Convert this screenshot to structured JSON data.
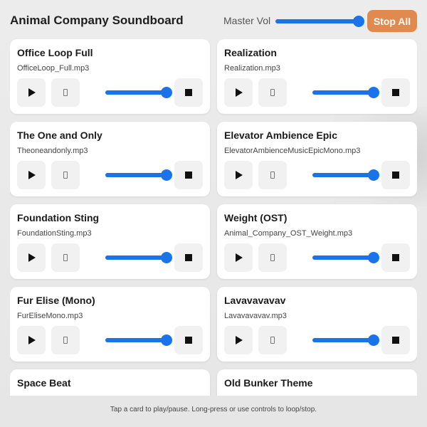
{
  "header": {
    "title": "Animal Company Soundboard",
    "master_vol_label": "Master Vol",
    "master_vol_level": 1.0,
    "stop_all_label": "Stop All"
  },
  "colors": {
    "accent": "#1a73e8",
    "stop_all": "#e08a4f",
    "card_bg": "#ffffff"
  },
  "icons": {
    "play": "play-icon",
    "loop": "loop-icon",
    "stop": "stop-icon"
  },
  "cards": [
    {
      "name": "Office Loop Full",
      "file": "OfficeLoop_Full.mp3",
      "volume": 1.0
    },
    {
      "name": "Realization",
      "file": "Realization.mp3",
      "volume": 1.0
    },
    {
      "name": "The One and Only",
      "file": "Theoneandonly.mp3",
      "volume": 1.0
    },
    {
      "name": "Elevator Ambience Epic",
      "file": "ElevatorAmbienceMusicEpicMono.mp3",
      "volume": 1.0
    },
    {
      "name": "Foundation Sting",
      "file": "FoundationSting.mp3",
      "volume": 1.0
    },
    {
      "name": "Weight (OST)",
      "file": "Animal_Company_OST_Weight.mp3",
      "volume": 1.0
    },
    {
      "name": "Fur Elise (Mono)",
      "file": "FurEliseMono.mp3",
      "volume": 1.0
    },
    {
      "name": "Lavavavavav",
      "file": "Lavavavavav.mp3",
      "volume": 1.0
    },
    {
      "name": "Space Beat",
      "file": "",
      "volume": 1.0
    },
    {
      "name": "Old Bunker Theme",
      "file": "",
      "volume": 1.0
    }
  ],
  "footer": {
    "hint": "Tap a card to play/pause. Long-press or use controls to loop/stop."
  }
}
